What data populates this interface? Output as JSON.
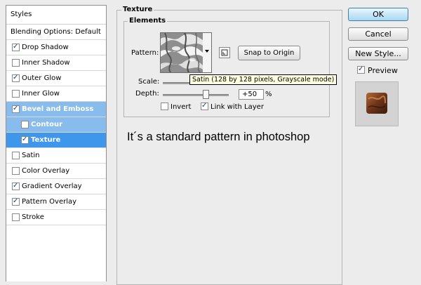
{
  "styles_panel": {
    "header": "Styles",
    "blending_options": "Blending Options: Default",
    "items": [
      {
        "label": "Drop Shadow",
        "checked": true,
        "state": "normal",
        "indent": false
      },
      {
        "label": "Inner Shadow",
        "checked": false,
        "state": "normal",
        "indent": false
      },
      {
        "label": "Outer Glow",
        "checked": true,
        "state": "normal",
        "indent": false
      },
      {
        "label": "Inner Glow",
        "checked": false,
        "state": "normal",
        "indent": false
      },
      {
        "label": "Bevel and Emboss",
        "checked": true,
        "state": "parent-selected",
        "indent": false
      },
      {
        "label": "Contour",
        "checked": false,
        "state": "parent-selected",
        "indent": true
      },
      {
        "label": "Texture",
        "checked": true,
        "state": "selected",
        "indent": true
      },
      {
        "label": "Satin",
        "checked": false,
        "state": "normal",
        "indent": false
      },
      {
        "label": "Color Overlay",
        "checked": false,
        "state": "normal",
        "indent": false
      },
      {
        "label": "Gradient Overlay",
        "checked": true,
        "state": "normal",
        "indent": false
      },
      {
        "label": "Pattern Overlay",
        "checked": true,
        "state": "normal",
        "indent": false
      },
      {
        "label": "Stroke",
        "checked": false,
        "state": "normal",
        "indent": false
      }
    ]
  },
  "texture": {
    "title": "Texture",
    "elements_title": "Elements",
    "pattern_label": "Pattern:",
    "snap_button": "Snap to Origin",
    "scale_label": "Scale:",
    "depth_label": "Depth:",
    "depth_value": "+50",
    "depth_unit": "%",
    "depth_level_percent": 50,
    "invert_label": "Invert",
    "invert_checked": false,
    "link_label": "Link with Layer",
    "link_checked": true,
    "tooltip": "Satin (128 by 128 pixels, Grayscale mode)"
  },
  "caption": "It´s a standard pattern in photoshop",
  "buttons": {
    "ok": "OK",
    "cancel": "Cancel",
    "new_style": "New Style...",
    "preview_label": "Preview",
    "preview_checked": true
  },
  "colors": {
    "selected_row": "#3f97ec",
    "parent_selected_row": "#88bcec",
    "ok_button": "#a9d7f3"
  }
}
